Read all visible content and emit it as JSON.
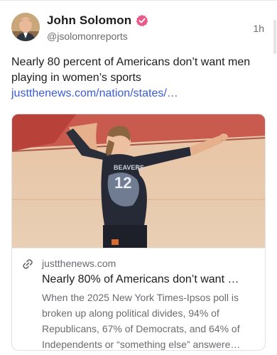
{
  "post": {
    "display_name": "John Solomon",
    "handle": "@jsolomonreports",
    "timestamp": "1h",
    "text": "Nearly 80 percent of Americans don’t want men playing in women’s sports",
    "link": "justthenews.com/nation/states/…",
    "verified_icon": "verified-badge-icon",
    "colors": {
      "verified": "#e85a8a",
      "link": "#3b5bd6"
    }
  },
  "card": {
    "domain": "justthenews.com",
    "title": "Nearly 80% of Americans don’t want …",
    "description": "When the 2025 New York Times-Ipsos poll is broken up along political divides, 94% of Republicans, 67% of Democrats, and 64% of Independents or “something else” answere…",
    "link_icon": "link-icon",
    "jersey_number": "12"
  }
}
